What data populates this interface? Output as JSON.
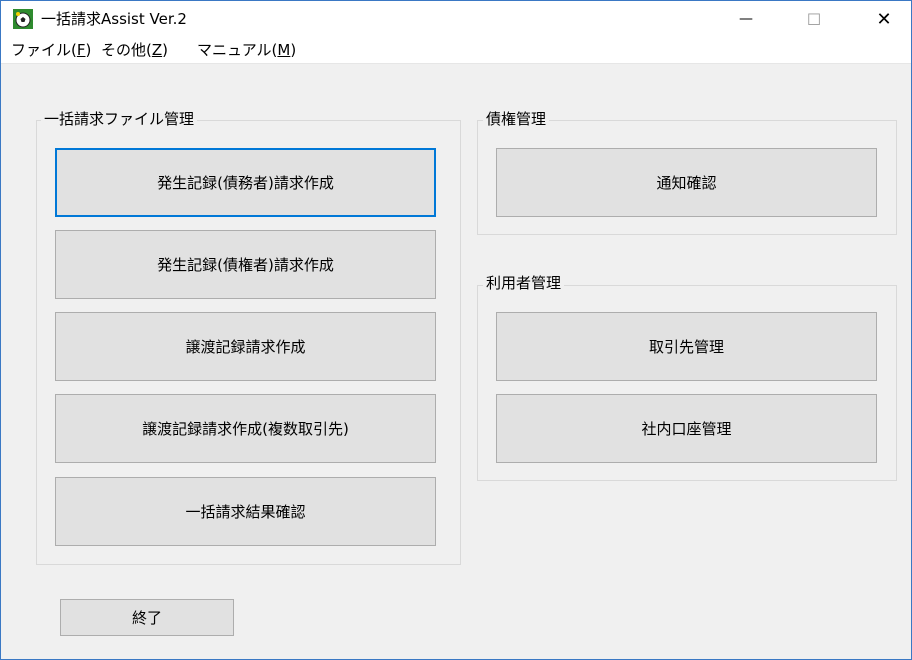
{
  "window": {
    "title": "一括請求Assist Ver.2"
  },
  "window_controls": {
    "minimize": "—",
    "maximize": "☐",
    "close": "✕"
  },
  "menu": [
    {
      "label": "ファイル(",
      "key": "F",
      "suffix": ")"
    },
    {
      "label": "その他(",
      "key": "Z",
      "suffix": ")"
    },
    {
      "label": "マニュアル(",
      "key": "M",
      "suffix": ")"
    }
  ],
  "groups": {
    "file_management": {
      "title": "一括請求ファイル管理",
      "buttons": [
        "発生記録(債務者)請求作成",
        "発生記録(債権者)請求作成",
        "譲渡記録請求作成",
        "譲渡記録請求作成(複数取引先)",
        "一括請求結果確認"
      ]
    },
    "credit_management": {
      "title": "債権管理",
      "buttons": [
        "通知確認"
      ]
    },
    "user_management": {
      "title": "利用者管理",
      "buttons": [
        "取引先管理",
        "社内口座管理"
      ]
    }
  },
  "exit_button": "終了",
  "colors": {
    "focus": "#0078d7",
    "button_bg": "#e1e1e1",
    "window_bg": "#f0f0f0"
  },
  "icons": {
    "app": "soccer-ball-icon"
  }
}
